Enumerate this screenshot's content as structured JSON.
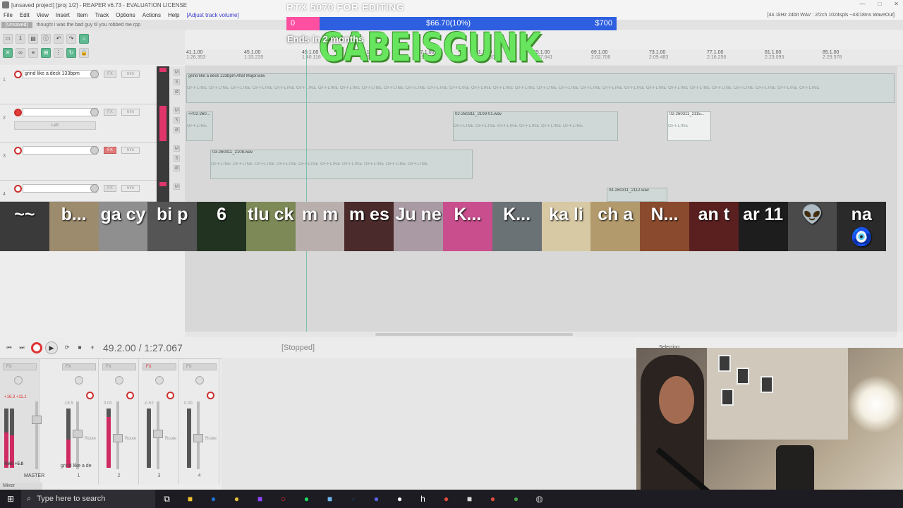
{
  "window": {
    "title": "[unsaved project] [proj 1/2] - REAPER v6.73 - EVALUATION LICENSE",
    "controls": [
      "—",
      "□",
      "✕"
    ]
  },
  "menu": {
    "items": [
      "File",
      "Edit",
      "View",
      "Insert",
      "Item",
      "Track",
      "Options",
      "Actions",
      "Help"
    ],
    "adjust": "[Adjust track volume]",
    "status_right": "[44.1kHz 24bit WAV : 2/2ch 1024spls ~43/18ms WaveOut]"
  },
  "tabs": {
    "active": "[Unsaved]",
    "second": "thought i was the bad guy til you robbed me.rpp"
  },
  "ruler": {
    "ticks": [
      {
        "bar": "41.1.00",
        "time": "1:26.353"
      },
      {
        "bar": "45.1.00",
        "time": "1:33.235"
      },
      {
        "bar": "49.1.00",
        "time": "1:40.116"
      },
      {
        "bar": "53.1.00",
        "time": "1:46.997"
      },
      {
        "bar": "57.1.00",
        "time": "1:53.878"
      },
      {
        "bar": "61.1.00",
        "time": "2:00.760"
      },
      {
        "bar": "65.1.00",
        "time": "2:07.641"
      },
      {
        "bar": "69.1.00",
        "time": "2:02.706"
      },
      {
        "bar": "73.1.00",
        "time": "2:09.483"
      },
      {
        "bar": "77.1.00",
        "time": "2:16.256"
      },
      {
        "bar": "81.1.00",
        "time": "2:23.093"
      },
      {
        "bar": "85.1.00",
        "time": "2:29.578"
      }
    ]
  },
  "tracks": [
    {
      "num": "1",
      "name": "grind like a deck 133bpm",
      "fx": "FX",
      "trim": "trim",
      "armed": false,
      "fx_active": false
    },
    {
      "num": "2",
      "name": "",
      "fx": "FX",
      "trim": "trim",
      "armed": true,
      "fx_active": false,
      "panel_label": "Left"
    },
    {
      "num": "3",
      "name": "",
      "fx": "FX",
      "trim": "trim",
      "armed": false,
      "fx_active": true
    },
    {
      "num": "4",
      "name": "",
      "fx": "FX",
      "trim": "trim",
      "armed": false,
      "fx_active": false
    }
  ],
  "track_buttons": [
    "M",
    "S",
    "Ø"
  ],
  "items": {
    "track1_label": "grind like a deck 133bpm Aflat Major.wav",
    "track2a_label": "<<02-260...",
    "track2b_label": "02-260311_2109-01.wav",
    "track2c_label": "02-260311_2115...",
    "track3_label": "03-260311_2108.wav",
    "track4_label": "04-260311_2112.wav",
    "offline_word": "OFFLINE"
  },
  "overlay": {
    "goal_title": "RTX 5070 FOR EDITING",
    "goal_start": "0",
    "goal_current": "$66.70(10%)",
    "goal_target": "$700",
    "goal_progress_pct": 10,
    "goal_sub": "Ends in 2 months",
    "logo": "GABEISGUNK",
    "bar_color": "#2e5fe0",
    "fill_color": "#ff4fa0",
    "logo_color": "#67e55e"
  },
  "chatters": [
    {
      "name": "~~",
      "bg": "#3a3a3a"
    },
    {
      "name": "b...",
      "bg": "#9c8b6d"
    },
    {
      "name": "ga cy",
      "bg": "#8f8f8f"
    },
    {
      "name": "bi p",
      "bg": "#555555"
    },
    {
      "name": "6",
      "bg": "#223322"
    },
    {
      "name": "tlu ck",
      "bg": "#7d8a58"
    },
    {
      "name": "m m",
      "bg": "#b9b0ae"
    },
    {
      "name": "m es",
      "bg": "#4a2a2a"
    },
    {
      "name": "Ju ne",
      "bg": "#a99aa3"
    },
    {
      "name": "K...",
      "bg": "#c94e8e"
    },
    {
      "name": "K...",
      "bg": "#6a7276"
    },
    {
      "name": "ka li",
      "bg": "#d8c9a5"
    },
    {
      "name": "ch a",
      "bg": "#b29a6d"
    },
    {
      "name": "N...",
      "bg": "#8a4a2d"
    },
    {
      "name": "an t",
      "bg": "#5a2020"
    },
    {
      "name": "ar 11",
      "bg": "#1d1d1d"
    },
    {
      "name": "👽",
      "bg": "#4a4a4a"
    },
    {
      "name": "na 🧿",
      "bg": "#2a2a2a"
    }
  ],
  "transport": {
    "time": "49.2.00 / 1:27.067",
    "status": "[Stopped]",
    "selection": "Selection:",
    "buttons": [
      "⏮",
      "⏭",
      "⟳",
      "■",
      "⏸"
    ]
  },
  "mixer": {
    "master_label": "MASTER",
    "mixer_tab": "Mixer",
    "rms": "RMS +5.8",
    "peak": "+16.3 +11.1",
    "strip_name": "grind like a de",
    "route": "Route",
    "strips": [
      {
        "num": "1",
        "vol": "-18.5",
        "level_pct": 48,
        "fx_active": false
      },
      {
        "num": "2",
        "vol": "0.00",
        "level_pct": 86,
        "fx_active": false
      },
      {
        "num": "3",
        "vol": "-0.52",
        "level_pct": 0,
        "fx_active": true
      },
      {
        "num": "4",
        "vol": "0.00",
        "level_pct": 0,
        "fx_active": false
      }
    ]
  },
  "taskbar": {
    "search_placeholder": "Type here to search",
    "apps": [
      {
        "name": "task-view",
        "glyph": "⧉",
        "color": "#ffffff"
      },
      {
        "name": "file-explorer",
        "glyph": "■",
        "color": "#f2c231"
      },
      {
        "name": "outlook",
        "glyph": "●",
        "color": "#1d73d9"
      },
      {
        "name": "chrome",
        "glyph": "●",
        "color": "#e6c13b"
      },
      {
        "name": "twitch",
        "glyph": "■",
        "color": "#9146ff"
      },
      {
        "name": "opera",
        "glyph": "○",
        "color": "#ff2b2b"
      },
      {
        "name": "spotify",
        "glyph": "●",
        "color": "#1ed760"
      },
      {
        "name": "notepad",
        "glyph": "■",
        "color": "#6fb5e8"
      },
      {
        "name": "steam",
        "glyph": "●",
        "color": "#1b2838"
      },
      {
        "name": "discord",
        "glyph": "●",
        "color": "#5865f2"
      },
      {
        "name": "obs",
        "glyph": "●",
        "color": "#ffffff"
      },
      {
        "name": "h-app",
        "glyph": "h",
        "color": "#ffffff"
      },
      {
        "name": "chrome-2",
        "glyph": "●",
        "color": "#e04d3c"
      },
      {
        "name": "epic",
        "glyph": "■",
        "color": "#d8d8d8"
      },
      {
        "name": "chrome-3",
        "glyph": "●",
        "color": "#e04d3c"
      },
      {
        "name": "chrome-4",
        "glyph": "●",
        "color": "#43a047"
      },
      {
        "name": "reaper",
        "glyph": "◍",
        "color": "#bbbbbb"
      }
    ]
  }
}
